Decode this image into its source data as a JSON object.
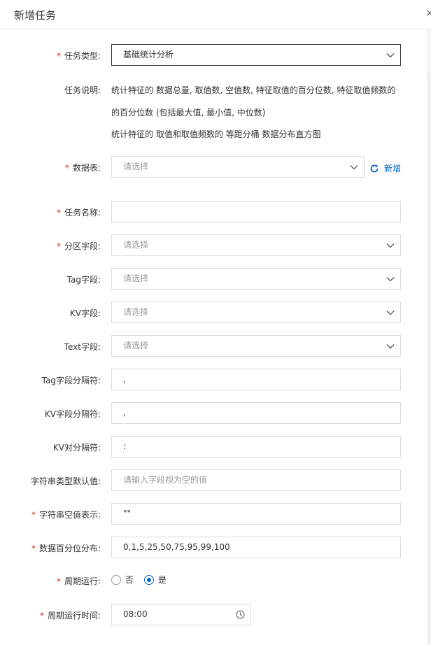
{
  "dialog": {
    "title": "新增任务",
    "close": "×"
  },
  "task_type": {
    "label": "任务类型:",
    "value": "基础统计分析",
    "required": true
  },
  "task_desc": {
    "label": "任务说明:",
    "lines": [
      "统计特征的 数据总量, 取值数, 空值数, 特征取值的百分位数, 特征取值频数的",
      "的百分位数 (包括最大值, 最小值, 中位数)",
      "统计特征的 取值和取值频数的 等距分桶 数据分布直方图"
    ]
  },
  "data_table": {
    "label": "数据表:",
    "placeholder": "请选择",
    "required": true,
    "add_label": "新增"
  },
  "task_name": {
    "label": "任务名称:",
    "value": "",
    "required": true
  },
  "partition_field": {
    "label": "分区字段:",
    "placeholder": "请选择",
    "required": true
  },
  "tag_field": {
    "label": "Tag字段:",
    "placeholder": "请选择"
  },
  "kv_field": {
    "label": "KV字段:",
    "placeholder": "请选择"
  },
  "text_field": {
    "label": "Text字段:",
    "placeholder": "请选择"
  },
  "tag_separator": {
    "label": "Tag字段分隔符:",
    "value": ","
  },
  "kv_separator": {
    "label": "KV字段分隔符:",
    "value": ","
  },
  "kv_pair_separator": {
    "label": "KV对分隔符:",
    "value": ":"
  },
  "string_default": {
    "label": "字符串类型默认值:",
    "placeholder": "请输入字段视为空的值"
  },
  "string_empty": {
    "label": "字符串空值表示:",
    "value": "\"\"",
    "required": true
  },
  "percentile": {
    "label": "数据百分位分布:",
    "value": "0,1,5,25,50,75,95,99,100",
    "required": true
  },
  "periodic": {
    "label": "周期运行:",
    "required": true,
    "options": [
      "否",
      "是"
    ],
    "selected": "是"
  },
  "periodic_time": {
    "label": "周期运行时间:",
    "value": "08:00",
    "required": true
  },
  "colors": {
    "required": "#d93026",
    "accent": "#0064c8",
    "border": "#dcdcdc",
    "placeholder": "#999999"
  }
}
